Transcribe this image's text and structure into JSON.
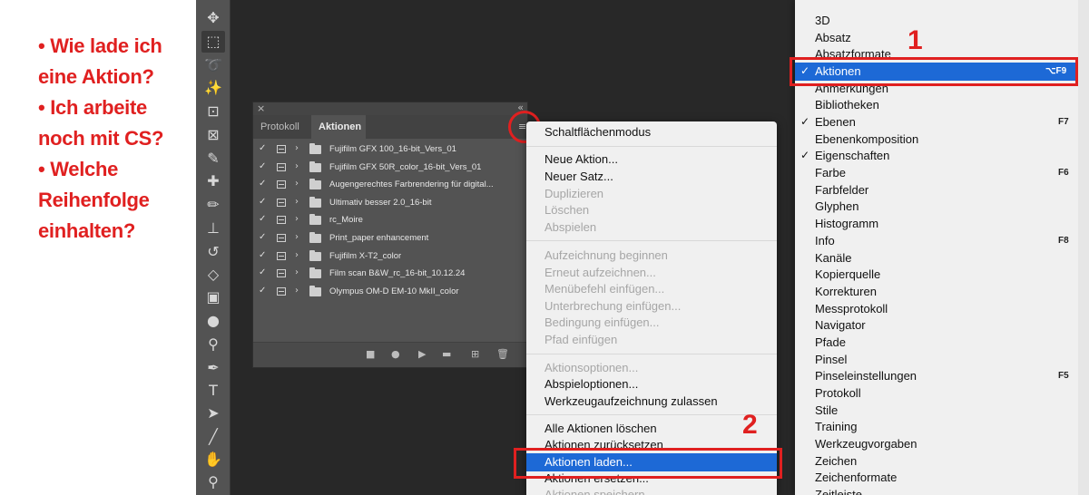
{
  "annotation": {
    "bullets": [
      {
        "lines": [
          "• Wie lade ich",
          "eine Aktion?"
        ]
      },
      {
        "lines": [
          "• Ich arbeite",
          "noch mit CS?"
        ]
      },
      {
        "lines": [
          "• Welche",
          "Reihenfolge",
          "einhalten?"
        ]
      }
    ],
    "step_1": "1",
    "step_2": "2",
    "accent_color": "#e02020"
  },
  "toolbar": {
    "tools": [
      {
        "name": "move-icon",
        "glyph": "✥",
        "selected": false
      },
      {
        "name": "marquee-icon",
        "glyph": "⬚",
        "selected": true
      },
      {
        "name": "lasso-icon",
        "glyph": "➰",
        "selected": false
      },
      {
        "name": "magic-wand-icon",
        "glyph": "✨",
        "selected": false
      },
      {
        "name": "crop-icon",
        "glyph": "⊡",
        "selected": false
      },
      {
        "name": "frame-icon",
        "glyph": "⊠",
        "selected": false
      },
      {
        "name": "eyedropper-icon",
        "glyph": "✎",
        "selected": false
      },
      {
        "name": "healing-brush-icon",
        "glyph": "✚",
        "selected": false
      },
      {
        "name": "brush-icon",
        "glyph": "✏",
        "selected": false
      },
      {
        "name": "clone-stamp-icon",
        "glyph": "⊥",
        "selected": false
      },
      {
        "name": "history-brush-icon",
        "glyph": "↺",
        "selected": false
      },
      {
        "name": "eraser-icon",
        "glyph": "◇",
        "selected": false
      },
      {
        "name": "gradient-icon",
        "glyph": "▣",
        "selected": false
      },
      {
        "name": "blur-icon",
        "glyph": "●",
        "selected": false
      },
      {
        "name": "dodge-icon",
        "glyph": "⚲",
        "selected": false
      },
      {
        "name": "pen-icon",
        "glyph": "✒",
        "selected": false
      },
      {
        "name": "type-icon",
        "glyph": "T",
        "selected": false
      },
      {
        "name": "path-selection-icon",
        "glyph": "➤",
        "selected": false
      },
      {
        "name": "line-icon",
        "glyph": "╱",
        "selected": false
      },
      {
        "name": "hand-icon",
        "glyph": "✋",
        "selected": false
      },
      {
        "name": "zoom-icon",
        "glyph": "⚲",
        "selected": false
      }
    ]
  },
  "actions_panel": {
    "tabs": {
      "protokoll": "Protokoll",
      "aktionen": "Aktionen"
    },
    "close_glyph": "×",
    "collapse_glyph": "«",
    "menu_glyph": "≡",
    "actions": [
      "Fujifilm GFX 100_16-bit_Vers_01",
      "Fujifilm GFX 50R_color_16-bit_Vers_01",
      "Augengerechtes Farbrendering für digital...",
      "Ultimativ besser 2.0_16-bit",
      "rc_Moire",
      "Print_paper enhancement",
      "Fujifilm X-T2_color",
      "Film scan B&W_rc_16-bit_10.12.24",
      "Olympus OM-D EM-10 MkII_color"
    ],
    "row_check": "✓",
    "row_arrow": "›",
    "bottom_buttons": [
      {
        "name": "stop-icon",
        "glyph": "■"
      },
      {
        "name": "record-icon",
        "glyph": "●"
      },
      {
        "name": "play-icon",
        "glyph": "▶"
      },
      {
        "name": "new-set-icon",
        "glyph": "▬"
      },
      {
        "name": "new-action-icon",
        "glyph": "⊞"
      },
      {
        "name": "trash-icon",
        "glyph": "🗑"
      }
    ]
  },
  "flyout_menu": {
    "items": [
      {
        "label": "Schaltflächenmodus",
        "disabled": false
      },
      {
        "label": "Neue Aktion...",
        "disabled": false
      },
      {
        "label": "Neuer Satz...",
        "disabled": false
      },
      {
        "label": "Duplizieren",
        "disabled": true
      },
      {
        "label": "Löschen",
        "disabled": true
      },
      {
        "label": "Abspielen",
        "disabled": true
      },
      {
        "label": "Aufzeichnung beginnen",
        "disabled": true
      },
      {
        "label": "Erneut aufzeichnen...",
        "disabled": true
      },
      {
        "label": "Menübefehl einfügen...",
        "disabled": true
      },
      {
        "label": "Unterbrechung einfügen...",
        "disabled": true
      },
      {
        "label": "Bedingung einfügen...",
        "disabled": true
      },
      {
        "label": "Pfad einfügen",
        "disabled": true
      },
      {
        "label": "Aktionsoptionen...",
        "disabled": true
      },
      {
        "label": "Abspieloptionen...",
        "disabled": false
      },
      {
        "label": "Werkzeugaufzeichnung zulassen",
        "disabled": false
      },
      {
        "label": "Alle Aktionen löschen",
        "disabled": false
      },
      {
        "label": "Aktionen zurücksetzen",
        "disabled": false
      },
      {
        "label": "Aktionen laden...",
        "disabled": false,
        "highlighted": true
      },
      {
        "label": "Aktionen ersetzen...",
        "disabled": false
      },
      {
        "label": "Aktionen speichern...",
        "disabled": true
      }
    ]
  },
  "window_menu": {
    "items": [
      {
        "label": "3D",
        "checked": false,
        "shortcut": ""
      },
      {
        "label": "Absatz",
        "checked": false,
        "shortcut": ""
      },
      {
        "label": "Absatzformate",
        "checked": false,
        "shortcut": ""
      },
      {
        "label": "Aktionen",
        "checked": true,
        "shortcut": "⌥F9",
        "highlighted": true
      },
      {
        "label": "Anmerkungen",
        "checked": false,
        "shortcut": ""
      },
      {
        "label": "Bibliotheken",
        "checked": false,
        "shortcut": ""
      },
      {
        "label": "Ebenen",
        "checked": true,
        "shortcut": "F7"
      },
      {
        "label": "Ebenenkomposition",
        "checked": false,
        "shortcut": ""
      },
      {
        "label": "Eigenschaften",
        "checked": true,
        "shortcut": ""
      },
      {
        "label": "Farbe",
        "checked": false,
        "shortcut": "F6"
      },
      {
        "label": "Farbfelder",
        "checked": false,
        "shortcut": ""
      },
      {
        "label": "Glyphen",
        "checked": false,
        "shortcut": ""
      },
      {
        "label": "Histogramm",
        "checked": false,
        "shortcut": ""
      },
      {
        "label": "Info",
        "checked": false,
        "shortcut": "F8"
      },
      {
        "label": "Kanäle",
        "checked": false,
        "shortcut": ""
      },
      {
        "label": "Kopierquelle",
        "checked": false,
        "shortcut": ""
      },
      {
        "label": "Korrekturen",
        "checked": false,
        "shortcut": ""
      },
      {
        "label": "Messprotokoll",
        "checked": false,
        "shortcut": ""
      },
      {
        "label": "Navigator",
        "checked": false,
        "shortcut": ""
      },
      {
        "label": "Pfade",
        "checked": false,
        "shortcut": ""
      },
      {
        "label": "Pinsel",
        "checked": false,
        "shortcut": ""
      },
      {
        "label": "Pinseleinstellungen",
        "checked": false,
        "shortcut": "F5"
      },
      {
        "label": "Protokoll",
        "checked": false,
        "shortcut": ""
      },
      {
        "label": "Stile",
        "checked": false,
        "shortcut": ""
      },
      {
        "label": "Training",
        "checked": false,
        "shortcut": ""
      },
      {
        "label": "Werkzeugvorgaben",
        "checked": false,
        "shortcut": ""
      },
      {
        "label": "Zeichen",
        "checked": false,
        "shortcut": ""
      },
      {
        "label": "Zeichenformate",
        "checked": false,
        "shortcut": ""
      },
      {
        "label": "Zeitleiste",
        "checked": false,
        "shortcut": ""
      }
    ],
    "check_glyph": "✓"
  }
}
